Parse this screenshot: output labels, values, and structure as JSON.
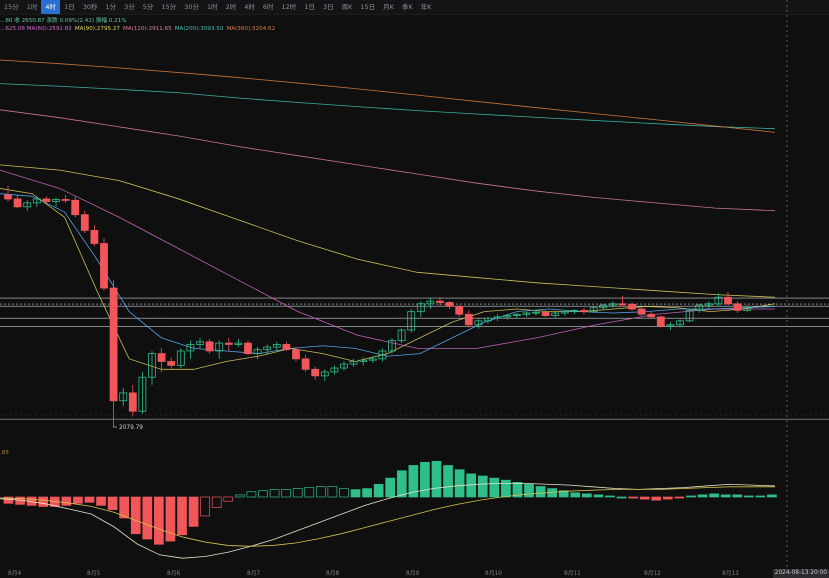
{
  "timeframes": [
    "15分",
    "1时",
    "4时",
    "1日",
    "30秒",
    "1分",
    "3分",
    "5分",
    "15分",
    "30分",
    "1时",
    "2时",
    "4时",
    "6时",
    "12时",
    "1日",
    "3日",
    "周K",
    "15日",
    "月K",
    "季K",
    "年K"
  ],
  "active_timeframe_index": 2,
  "info_line1": [
    {
      "text": "...80 收 2650.87 涨跌 0.09%(2.42) 振幅 0.21%",
      "color": "#5fc7a7"
    }
  ],
  "info_line2": [
    {
      "text": "...625.08 MA(60):2592.82",
      "color": "#d06acc"
    },
    {
      "text": "MA(90):2795.27",
      "color": "#e1d35c"
    },
    {
      "text": "MA(120):2911.65",
      "color": "#e07fa5"
    },
    {
      "text": "MA(200):3093.50",
      "color": "#3ec0b0"
    },
    {
      "text": "MA(360):3204.62",
      "color": "#e07d3a"
    }
  ],
  "macd_label": ".85",
  "timestamp": "2024-08-13 20:00",
  "colors": {
    "up": "#2fbf8a",
    "down": "#f0565a",
    "bg": "#0f0f10"
  },
  "chart_data": {
    "type": "candlestick",
    "symbol_timeframe": "1时",
    "x_labels": [
      "8月4",
      "8月5",
      "8月6",
      "8月7",
      "8月8",
      "8月9",
      "8月10",
      "8月11",
      "8月12",
      "8月13"
    ],
    "low_annotation": "2079.79",
    "candles": [
      [
        2965,
        3000,
        2940,
        2950
      ],
      [
        2950,
        2965,
        2915,
        2920
      ],
      [
        2920,
        2945,
        2905,
        2935
      ],
      [
        2935,
        2955,
        2920,
        2950
      ],
      [
        2950,
        2960,
        2935,
        2940
      ],
      [
        2940,
        2955,
        2920,
        2948
      ],
      [
        2948,
        2965,
        2935,
        2945
      ],
      [
        2945,
        2960,
        2880,
        2890
      ],
      [
        2890,
        2905,
        2820,
        2830
      ],
      [
        2830,
        2850,
        2770,
        2780
      ],
      [
        2780,
        2800,
        2600,
        2610
      ],
      [
        2610,
        2640,
        2080,
        2180
      ],
      [
        2180,
        2230,
        2160,
        2210
      ],
      [
        2210,
        2240,
        2120,
        2140
      ],
      [
        2140,
        2290,
        2130,
        2270
      ],
      [
        2270,
        2370,
        2240,
        2360
      ],
      [
        2360,
        2380,
        2290,
        2330
      ],
      [
        2330,
        2345,
        2300,
        2315
      ],
      [
        2315,
        2380,
        2305,
        2370
      ],
      [
        2370,
        2410,
        2340,
        2395
      ],
      [
        2395,
        2420,
        2380,
        2405
      ],
      [
        2405,
        2415,
        2360,
        2370
      ],
      [
        2370,
        2410,
        2340,
        2400
      ],
      [
        2400,
        2420,
        2370,
        2395
      ],
      [
        2395,
        2415,
        2385,
        2400
      ],
      [
        2400,
        2410,
        2355,
        2360
      ],
      [
        2360,
        2385,
        2340,
        2375
      ],
      [
        2375,
        2395,
        2355,
        2385
      ],
      [
        2385,
        2405,
        2370,
        2395
      ],
      [
        2395,
        2405,
        2370,
        2375
      ],
      [
        2375,
        2385,
        2330,
        2340
      ],
      [
        2340,
        2355,
        2290,
        2300
      ],
      [
        2300,
        2310,
        2260,
        2275
      ],
      [
        2275,
        2300,
        2255,
        2290
      ],
      [
        2290,
        2315,
        2280,
        2305
      ],
      [
        2305,
        2330,
        2295,
        2320
      ],
      [
        2320,
        2340,
        2310,
        2330
      ],
      [
        2330,
        2345,
        2315,
        2335
      ],
      [
        2335,
        2350,
        2325,
        2340
      ],
      [
        2340,
        2380,
        2330,
        2370
      ],
      [
        2370,
        2420,
        2360,
        2410
      ],
      [
        2410,
        2455,
        2400,
        2450
      ],
      [
        2450,
        2530,
        2440,
        2520
      ],
      [
        2520,
        2560,
        2500,
        2550
      ],
      [
        2550,
        2570,
        2530,
        2560
      ],
      [
        2560,
        2570,
        2545,
        2555
      ],
      [
        2555,
        2560,
        2530,
        2540
      ],
      [
        2540,
        2545,
        2500,
        2510
      ],
      [
        2510,
        2525,
        2460,
        2470
      ],
      [
        2470,
        2490,
        2455,
        2485
      ],
      [
        2485,
        2500,
        2475,
        2495
      ],
      [
        2495,
        2510,
        2485,
        2500
      ],
      [
        2500,
        2510,
        2490,
        2505
      ],
      [
        2505,
        2515,
        2495,
        2510
      ],
      [
        2510,
        2520,
        2500,
        2515
      ],
      [
        2515,
        2525,
        2505,
        2518
      ],
      [
        2518,
        2525,
        2500,
        2505
      ],
      [
        2505,
        2520,
        2495,
        2515
      ],
      [
        2515,
        2525,
        2505,
        2520
      ],
      [
        2520,
        2530,
        2510,
        2525
      ],
      [
        2525,
        2535,
        2510,
        2520
      ],
      [
        2520,
        2540,
        2515,
        2535
      ],
      [
        2535,
        2550,
        2525,
        2545
      ],
      [
        2545,
        2560,
        2535,
        2550
      ],
      [
        2550,
        2580,
        2540,
        2548
      ],
      [
        2548,
        2555,
        2525,
        2530
      ],
      [
        2530,
        2535,
        2505,
        2510
      ],
      [
        2510,
        2520,
        2495,
        2500
      ],
      [
        2500,
        2505,
        2460,
        2465
      ],
      [
        2465,
        2480,
        2450,
        2470
      ],
      [
        2470,
        2490,
        2460,
        2485
      ],
      [
        2485,
        2530,
        2480,
        2525
      ],
      [
        2525,
        2550,
        2515,
        2545
      ],
      [
        2545,
        2560,
        2530,
        2550
      ],
      [
        2550,
        2590,
        2540,
        2575
      ],
      [
        2575,
        2595,
        2545,
        2550
      ],
      [
        2550,
        2560,
        2515,
        2525
      ],
      [
        2525,
        2545,
        2520,
        2535
      ]
    ],
    "price_levels": [
      2572,
      2549,
      2541,
      2495,
      2463,
      2110
    ],
    "moving_averages": [
      {
        "name": "MA(60)",
        "color": "#d06acc",
        "values": [
          3060,
          2990,
          2880,
          2760,
          2640,
          2520,
          2430,
          2380,
          2380,
          2420,
          2470,
          2510,
          2530,
          2530
        ]
      },
      {
        "name": "MA(90)",
        "color": "#e1d35c",
        "values": [
          3080,
          3060,
          3020,
          2950,
          2870,
          2790,
          2720,
          2670,
          2650,
          2630,
          2615,
          2600,
          2585,
          2575
        ]
      },
      {
        "name": "MA(120)",
        "color": "#e07fa5",
        "values": [
          3290,
          3260,
          3225,
          3190,
          3150,
          3115,
          3080,
          3045,
          3010,
          2980,
          2955,
          2935,
          2915,
          2905
        ]
      },
      {
        "name": "MA(200)",
        "color": "#3ec0b0",
        "values": [
          3390,
          3380,
          3368,
          3355,
          3335,
          3318,
          3302,
          3287,
          3274,
          3261,
          3249,
          3237,
          3226,
          3218
        ]
      },
      {
        "name": "MA(360)",
        "color": "#e07d3a",
        "values": [
          3480,
          3466,
          3450,
          3432,
          3413,
          3392,
          3370,
          3346,
          3322,
          3298,
          3275,
          3252,
          3228,
          3204
        ]
      },
      {
        "name": "MA(short1)",
        "color": "#dccd58",
        "values": [
          2990,
          2970,
          2880,
          2600,
          2340,
          2300,
          2300,
          2330,
          2350,
          2380,
          2360,
          2330,
          2360,
          2420,
          2480,
          2520,
          2530,
          2520,
          2520,
          2530,
          2540,
          2535,
          2520,
          2530,
          2550
        ]
      },
      {
        "name": "MA(short2)",
        "color": "#5bb1ff",
        "values": [
          2970,
          2960,
          2900,
          2720,
          2520,
          2420,
          2380,
          2370,
          2360,
          2380,
          2390,
          2380,
          2350,
          2360,
          2420,
          2480,
          2520,
          2530,
          2520,
          2515,
          2520,
          2530,
          2530,
          2535,
          2540
        ]
      }
    ],
    "macd_histogram": [
      -6,
      -7,
      -8,
      -9,
      -9,
      -8,
      -6,
      -5,
      -8,
      -12,
      -20,
      -35,
      -40,
      -45,
      -42,
      -36,
      -28,
      -18,
      -10,
      -4,
      2,
      5,
      6,
      7,
      7,
      8,
      9,
      10,
      10,
      8,
      7,
      8,
      12,
      18,
      25,
      30,
      33,
      34,
      30,
      26,
      22,
      20,
      18,
      16,
      14,
      12,
      10,
      8,
      6,
      4,
      3,
      2,
      1,
      0,
      -1,
      -2,
      -3,
      -2,
      -1,
      1,
      2,
      3,
      2,
      2,
      1,
      1,
      2
    ],
    "macd_dif": [
      -2,
      -4,
      -8,
      -14,
      -20,
      -35,
      -55,
      -68,
      -72,
      -70,
      -65,
      -58,
      -50,
      -40,
      -30,
      -20,
      -10,
      -2,
      5,
      10,
      13,
      15,
      16,
      16,
      15,
      14,
      12,
      10,
      9,
      10,
      11,
      13,
      15,
      14,
      13
    ],
    "macd_dea": [
      -1,
      -2,
      -4,
      -7,
      -11,
      -18,
      -28,
      -38,
      -47,
      -53,
      -57,
      -58,
      -57,
      -54,
      -49,
      -43,
      -36,
      -29,
      -22,
      -15,
      -9,
      -4,
      0,
      3,
      5,
      7,
      8,
      9,
      9,
      9,
      10,
      11,
      12,
      12,
      12
    ]
  }
}
